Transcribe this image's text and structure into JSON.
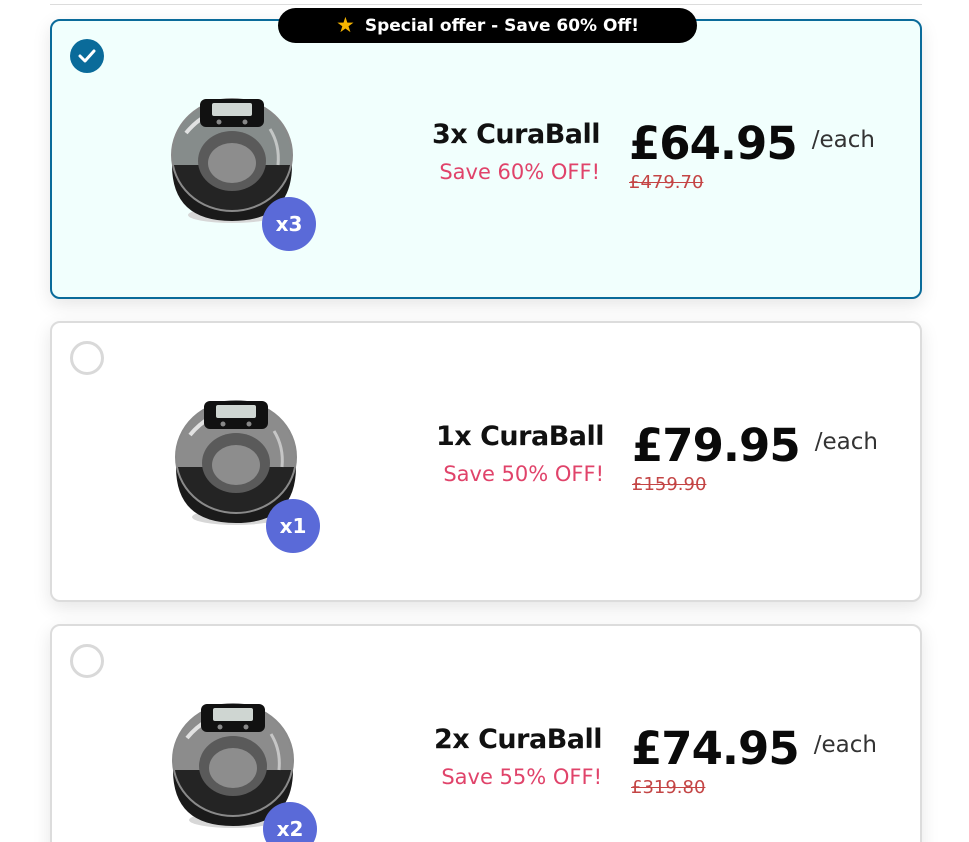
{
  "banner": {
    "icon": "star-icon",
    "text": "Special offer - Save 60% Off!"
  },
  "offers": [
    {
      "name": "3x CuraBall",
      "save": "Save 60% OFF!",
      "price": "£64.95",
      "per_unit": "/each",
      "old_price": "£479.70",
      "badge": "x3",
      "selected": true
    },
    {
      "name": "1x CuraBall",
      "save": "Save 50% OFF!",
      "price": "£79.95",
      "per_unit": "/each",
      "old_price": "£159.90",
      "badge": "x1",
      "selected": false
    },
    {
      "name": "2x CuraBall",
      "save": "Save 55% OFF!",
      "price": "£74.95",
      "per_unit": "/each",
      "old_price": "£319.80",
      "badge": "x2",
      "selected": false
    }
  ],
  "colors": {
    "selected_border": "#0a6b9a",
    "selected_background": "#f1fffd",
    "save_text": "#e0436a",
    "badge": "#5a6ad8",
    "old_price": "#c44545"
  }
}
